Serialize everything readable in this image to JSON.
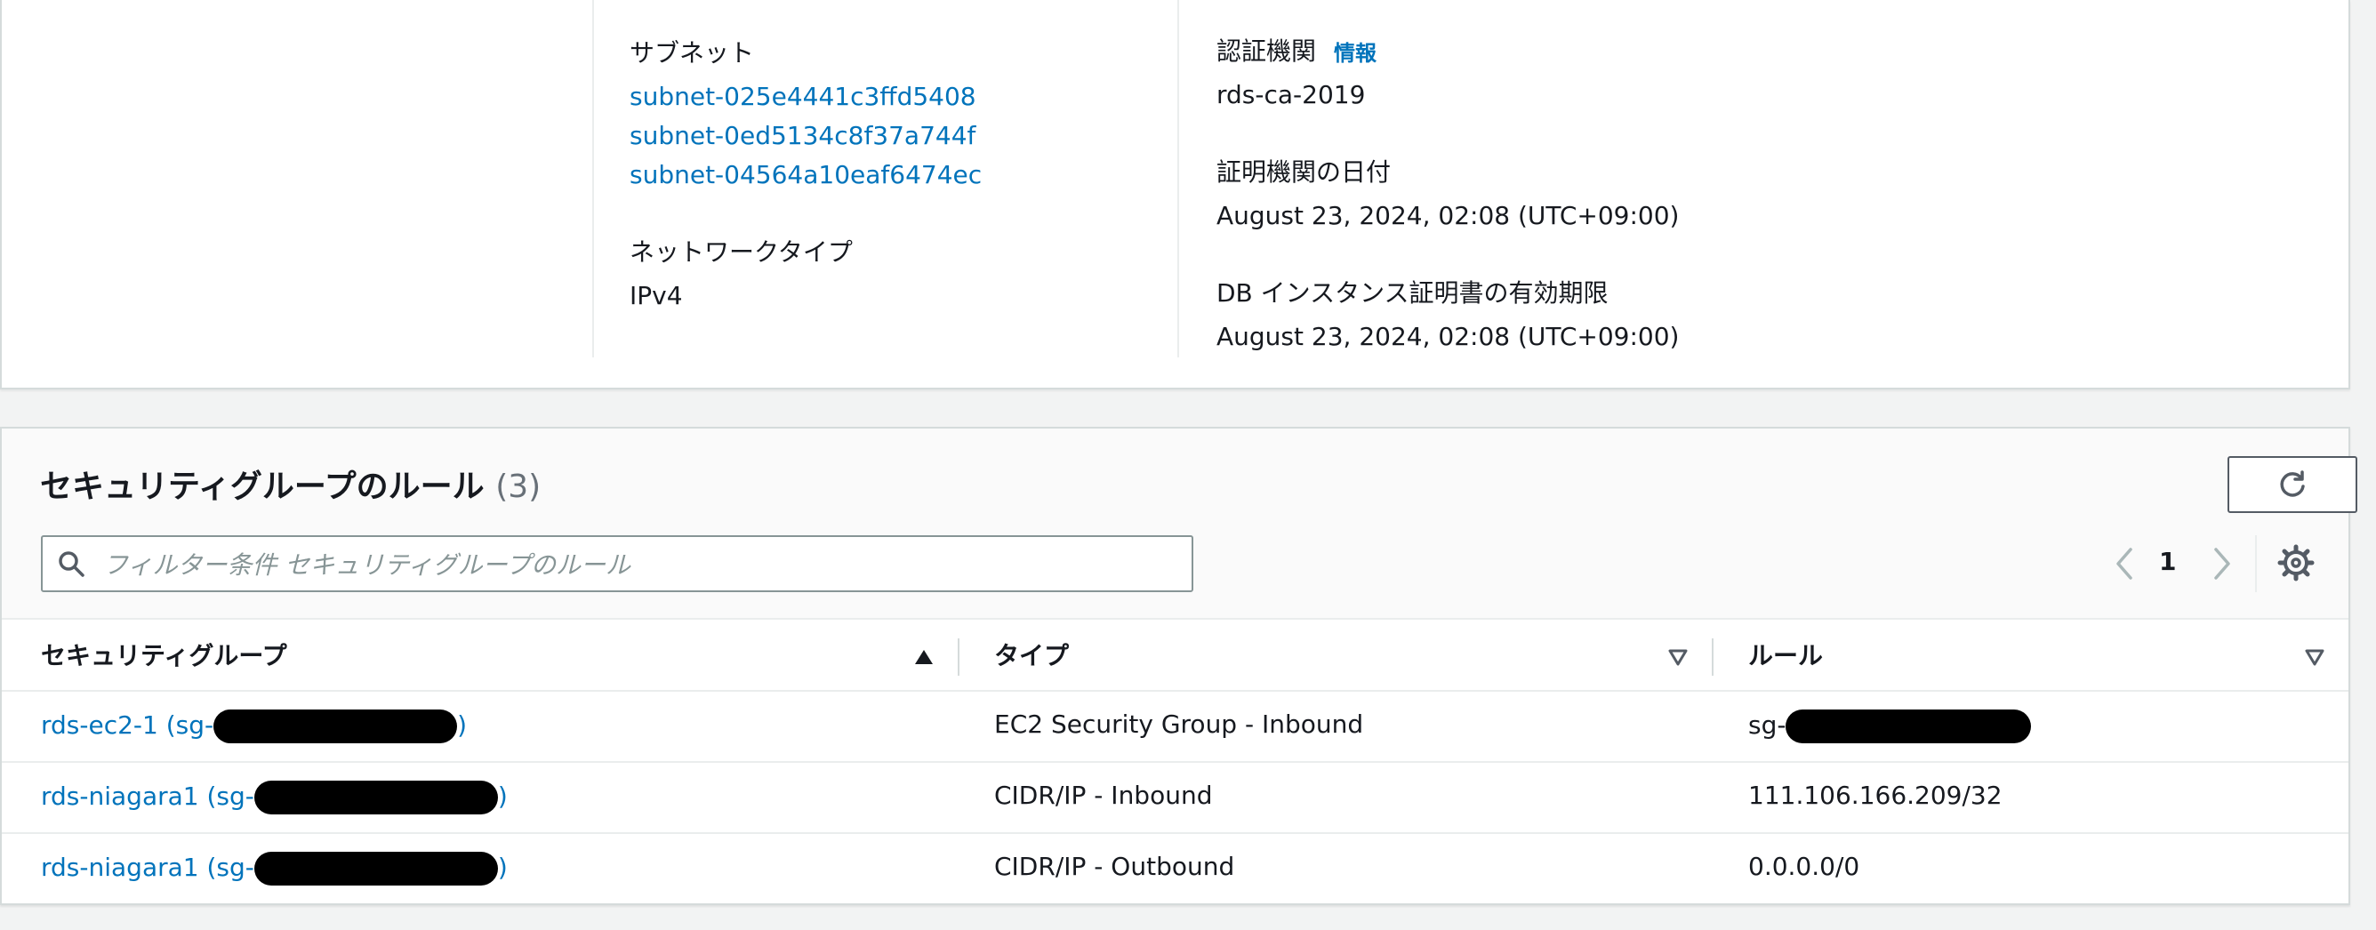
{
  "details": {
    "subnets_label": "サブネット",
    "subnets": [
      "subnet-025e4441c3ffd5408",
      "subnet-0ed5134c8f37a744f",
      "subnet-04564a10eaf6474ec"
    ],
    "network_type_label": "ネットワークタイプ",
    "network_type_value": "IPv4",
    "ca_label": "認証機関",
    "ca_info_link": "情報",
    "ca_value": "rds-ca-2019",
    "ca_date_label": "証明機関の日付",
    "ca_date_value": "August 23, 2024, 02:08 (UTC+09:00)",
    "cert_expiry_label": "DB インスタンス証明書の有効期限",
    "cert_expiry_value": "August 23, 2024, 02:08 (UTC+09:00)"
  },
  "rules": {
    "title": "セキュリティグループのルール",
    "count": "(3)",
    "search_placeholder": "フィルター条件 セキュリティグループのルール",
    "page": "1",
    "columns": [
      "セキュリティグループ",
      "タイプ",
      "ルール"
    ],
    "rows": [
      {
        "group_prefix": "rds-ec2-1 (sg-",
        "group_suffix": ")",
        "type": "EC2 Security Group - Inbound",
        "rule": "sg-",
        "rule_redacted": true
      },
      {
        "group_prefix": "rds-niagara1 (sg-",
        "group_suffix": ")",
        "type": "CIDR/IP - Inbound",
        "rule": "111.106.166.209/32",
        "rule_redacted": false
      },
      {
        "group_prefix": "rds-niagara1 (sg-",
        "group_suffix": ")",
        "type": "CIDR/IP - Outbound",
        "rule": "0.0.0.0/0",
        "rule_redacted": false
      }
    ]
  },
  "colors": {
    "link": "#0073bb",
    "text": "#16191f",
    "muted": "#687078"
  }
}
